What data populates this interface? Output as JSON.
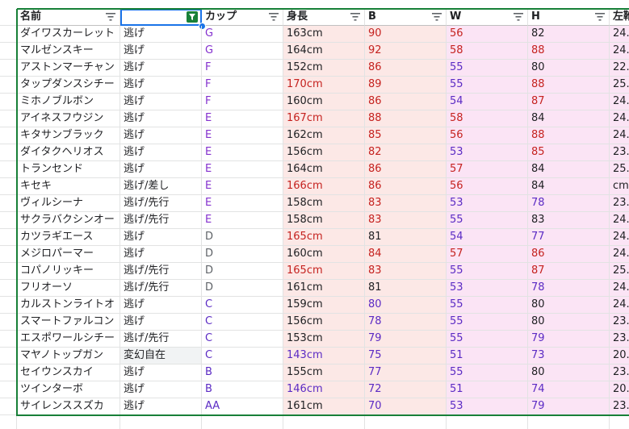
{
  "headers": [
    "名前",
    "",
    "カップ",
    "身長",
    "B",
    "W",
    "H",
    "左靴"
  ],
  "rows": [
    [
      "ダイワスカーレット",
      "逃げ",
      "G",
      "163cm",
      "90",
      "56",
      "82",
      "24."
    ],
    [
      "マルゼンスキー",
      "逃げ",
      "G",
      "164cm",
      "92",
      "58",
      "88",
      "24."
    ],
    [
      "アストンマーチャン",
      "逃げ",
      "F",
      "152cm",
      "86",
      "55",
      "80",
      "22."
    ],
    [
      "タップダンスシチー",
      "逃げ",
      "F",
      "170cm",
      "89",
      "55",
      "88",
      "25."
    ],
    [
      "ミホノブルボン",
      "逃げ",
      "F",
      "160cm",
      "86",
      "54",
      "87",
      "24."
    ],
    [
      "アイネスフウジン",
      "逃げ",
      "E",
      "167cm",
      "88",
      "58",
      "84",
      "24."
    ],
    [
      "キタサンブラック",
      "逃げ",
      "E",
      "162cm",
      "85",
      "56",
      "88",
      "24."
    ],
    [
      "ダイタクヘリオス",
      "逃げ",
      "E",
      "156cm",
      "82",
      "53",
      "85",
      "23."
    ],
    [
      "トランセンド",
      "逃げ",
      "E",
      "164cm",
      "86",
      "57",
      "84",
      "25."
    ],
    [
      "キセキ",
      "逃げ/差し",
      "E",
      "166cm",
      "86",
      "56",
      "84",
      "cm"
    ],
    [
      "ヴィルシーナ",
      "逃げ/先行",
      "E",
      "158cm",
      "83",
      "53",
      "78",
      "23."
    ],
    [
      "サクラバクシンオー",
      "逃げ/先行",
      "E",
      "158cm",
      "83",
      "55",
      "83",
      "24."
    ],
    [
      "カツラギエース",
      "逃げ",
      "D",
      "165cm",
      "81",
      "54",
      "77",
      "24."
    ],
    [
      "メジロパーマー",
      "逃げ",
      "D",
      "160cm",
      "84",
      "57",
      "86",
      "24."
    ],
    [
      "コパノリッキー",
      "逃げ/先行",
      "D",
      "165cm",
      "83",
      "55",
      "87",
      "25."
    ],
    [
      "フリオーソ",
      "逃げ/先行",
      "D",
      "161cm",
      "81",
      "53",
      "78",
      "24."
    ],
    [
      "カルストンライトオ",
      "逃げ",
      "C",
      "159cm",
      "80",
      "55",
      "80",
      "24."
    ],
    [
      "スマートファルコン",
      "逃げ",
      "C",
      "156cm",
      "78",
      "55",
      "80",
      "23."
    ],
    [
      "エスポワールシチー",
      "逃げ/先行",
      "C",
      "153cm",
      "79",
      "55",
      "79",
      "23."
    ],
    [
      "マヤノトップガン",
      "変幻自在",
      "C",
      "143cm",
      "75",
      "51",
      "73",
      "20."
    ],
    [
      "セイウンスカイ",
      "逃げ",
      "B",
      "155cm",
      "77",
      "55",
      "80",
      "23."
    ],
    [
      "ツインターボ",
      "逃げ",
      "B",
      "146cm",
      "72",
      "51",
      "74",
      "20."
    ],
    [
      "サイレンススズカ",
      "逃げ",
      "AA",
      "161cm",
      "70",
      "53",
      "79",
      "23."
    ]
  ],
  "icons": {
    "filter": "filter-icon",
    "active_filter": "active-filter-icon"
  },
  "colors": {
    "accent": "#1a73e8",
    "filter_green": "#188038",
    "cup_purple": "#8430ce",
    "height_red": "#c5221f",
    "bwh_pink": "#fce8e6"
  }
}
